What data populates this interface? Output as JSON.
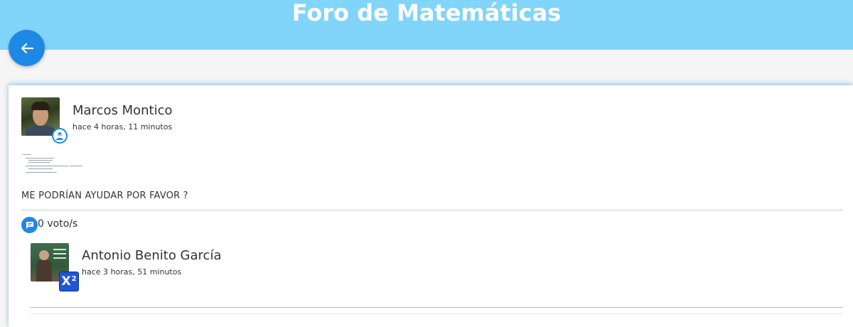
{
  "header": {
    "title": "Foro de Matemáticas",
    "background": "#81d4fa",
    "back_icon": "arrow-left-icon"
  },
  "post": {
    "author": "Marcos Montico",
    "time": "hace 4 horas, 11 minutos",
    "badge_icon": "user-badge-icon",
    "text": "ME PODRÍAN AYUDAR POR FAVOR ?",
    "votes": "0 voto/s",
    "comment_icon": "comment-icon"
  },
  "reply": {
    "author": "Antonio Benito García",
    "time": "hace 3 horas, 51 minutos",
    "badge_label": "X",
    "badge_sup": "2"
  },
  "colors": {
    "accent": "#1e88e5",
    "badge_blue": "#1f57d6"
  }
}
